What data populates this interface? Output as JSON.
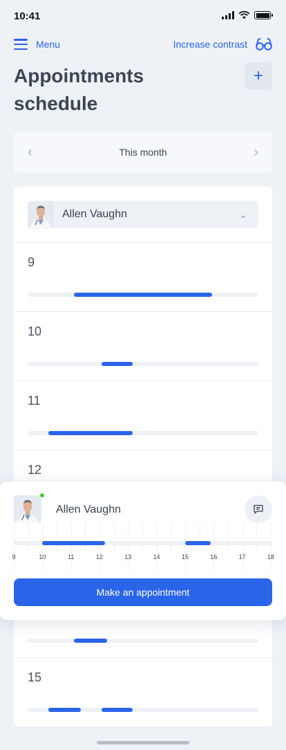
{
  "status": {
    "time": "10:41"
  },
  "nav": {
    "menu_label": "Menu",
    "contrast_label": "Increase contrast"
  },
  "page": {
    "title": "Appointments schedule",
    "add_label": "+"
  },
  "period": {
    "label": "This month"
  },
  "doctor": {
    "name": "Allen Vaughn"
  },
  "days": [
    {
      "day": "9",
      "segments": [
        [
          0.2,
          0.8
        ]
      ]
    },
    {
      "day": "10",
      "segments": [
        [
          0.32,
          0.455
        ]
      ]
    },
    {
      "day": "11",
      "segments": [
        [
          0.09,
          0.455
        ]
      ]
    },
    {
      "day": "12",
      "segments": []
    },
    {
      "day": "",
      "segments": []
    },
    {
      "day": "",
      "segments": [
        [
          0.2,
          0.345
        ]
      ]
    },
    {
      "day": "15",
      "segments": [
        [
          0.09,
          0.23
        ],
        [
          0.32,
          0.455
        ]
      ]
    }
  ],
  "popup": {
    "doctor_name": "Allen Vaughn",
    "status_color": "#43c933",
    "hours": [
      "9",
      "10",
      "11",
      "12",
      "13",
      "14",
      "15",
      "16",
      "17",
      "18"
    ],
    "busy": [
      [
        10,
        12.2
      ],
      [
        15,
        15.9
      ]
    ],
    "button_label": "Make an appointment"
  },
  "colors": {
    "accent": "#2a64e8",
    "track": "#eef1f5"
  }
}
